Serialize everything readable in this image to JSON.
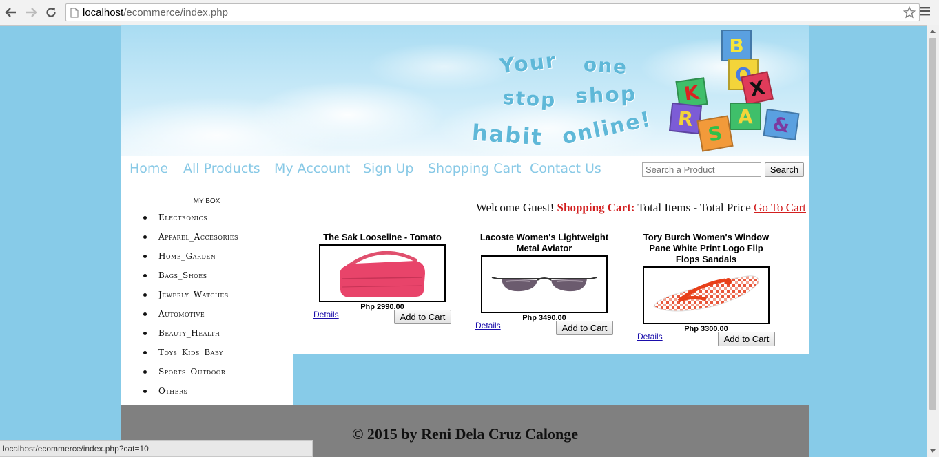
{
  "browser": {
    "url_host": "localhost",
    "url_path": "/ecommerce/index.php"
  },
  "banner": {
    "slogan_words": [
      "Your",
      "one",
      "stop",
      "shop",
      "habit",
      "online!"
    ],
    "block_letters": [
      "B",
      "O",
      "X",
      "K",
      "R",
      "A",
      "S",
      "&"
    ]
  },
  "nav": {
    "items": [
      "Home",
      "All Products",
      "My Account",
      "Sign Up",
      "Shopping Cart",
      "Contact Us"
    ],
    "search_placeholder": "Search a Product",
    "search_button": "Search"
  },
  "sidebar": {
    "title": "MY BOX",
    "categories": [
      "Electronics",
      "Apparel_Accesories",
      "Home_Garden",
      "Bags_Shoes",
      "Jewerly_Watches",
      "Automotive",
      "Beauty_Health",
      "Toys_Kids_Baby",
      "Sports_Outdoor",
      "Others"
    ]
  },
  "welcome": {
    "greeting": "Welcome Guest!",
    "cart_label": "Shopping Cart:",
    "summary": "Total Items - Total Price",
    "link": "Go To Cart"
  },
  "products": [
    {
      "name": "The Sak Looseline - Tomato",
      "price": "Php 2990.00",
      "details": "Details",
      "add_to_cart": "Add to Cart"
    },
    {
      "name": "Lacoste Women's Lightweight Metal Aviator",
      "price": "Php 3490.00",
      "details": "Details",
      "add_to_cart": "Add to Cart"
    },
    {
      "name": "Tory Burch Women's Window Pane White Print Logo Flip Flops Sandals",
      "price": "Php 3300.00",
      "details": "Details",
      "add_to_cart": "Add to Cart"
    }
  ],
  "footer": {
    "text": "© 2015 by Reni Dela Cruz Calonge"
  },
  "status_bar": {
    "text": "localhost/ecommerce/index.php?cat=10"
  },
  "colors": {
    "page_bg": "#87cbe8",
    "nav_link": "#88c9e6",
    "cart_red": "#d21f1f",
    "footer_bg": "#808080"
  }
}
